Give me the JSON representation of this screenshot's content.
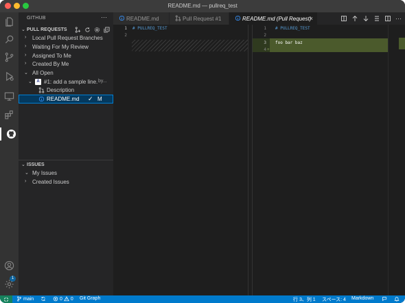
{
  "window": {
    "title": "README.md — pullreq_test"
  },
  "sidebar": {
    "title": "GITHUB",
    "pull_requests": {
      "header": "PULL REQUESTS",
      "items": [
        {
          "label": "Local Pull Request Branches"
        },
        {
          "label": "Waiting For My Review"
        },
        {
          "label": "Assigned To Me"
        },
        {
          "label": "Created By Me"
        },
        {
          "label": "All Open"
        }
      ],
      "pr": {
        "avatar": "A",
        "title": "#1: add a sample line.",
        "author": "by...",
        "description_label": "Description",
        "file_label": "README.md",
        "file_status": "M"
      }
    },
    "issues": {
      "header": "ISSUES",
      "items": [
        {
          "label": "My Issues"
        },
        {
          "label": "Created Issues"
        }
      ]
    }
  },
  "tabs": [
    {
      "label": "README.md"
    },
    {
      "label": "Pull Request #1"
    },
    {
      "label": "README.md (Pull Request)"
    }
  ],
  "editor_left": {
    "line_numbers": [
      "1",
      "2"
    ],
    "lines": [
      "# PULLREQ_TEST",
      ""
    ]
  },
  "editor_right": {
    "line_numbers": [
      "1",
      "2",
      "3",
      "4"
    ],
    "added_marker": "+",
    "lines": [
      "# PULLREQ_TEST",
      "",
      "foo bar baz",
      ""
    ]
  },
  "statusbar": {
    "branch": "main",
    "errors": "0",
    "warnings": "0",
    "git_graph": "Git Graph",
    "cursor": "行 3、列 1",
    "spaces": "スペース: 4",
    "language": "Markdown"
  },
  "activity": {
    "accounts_badge": "1"
  },
  "colors": {
    "accent": "#007acc",
    "selection": "#04395e",
    "added": "#4b5a2c",
    "remote": "#16825d"
  }
}
